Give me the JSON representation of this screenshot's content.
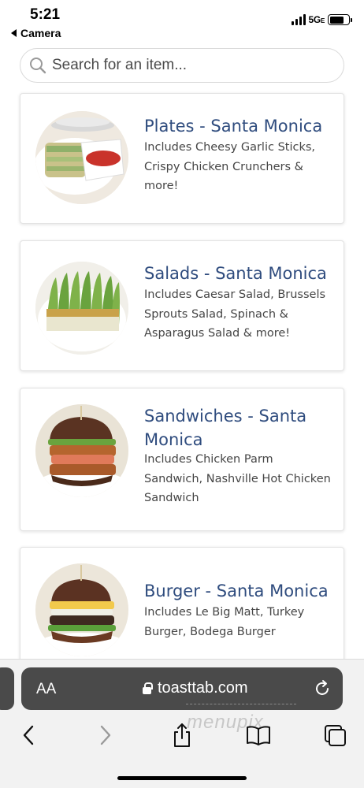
{
  "status": {
    "time": "5:21",
    "back_app": "Camera",
    "network": "5G",
    "network_suffix": "E"
  },
  "search": {
    "placeholder": "Search for an item..."
  },
  "categories": [
    {
      "title": "Plates - Santa Monica",
      "description": "Includes Cheesy Garlic Sticks, Crispy Chicken Crunchers & more!",
      "image_icon": "plates-food-image"
    },
    {
      "title": "Salads - Santa Monica",
      "description": "Includes Caesar Salad, Brussels Sprouts Salad, Spinach & Asparagus Salad & more!",
      "image_icon": "salad-food-image"
    },
    {
      "title": "Sandwiches - Santa Monica",
      "description": "Includes Chicken Parm Sandwich, Nashville Hot Chicken Sandwich",
      "image_icon": "sandwich-food-image"
    },
    {
      "title": "Burger - Santa Monica",
      "description": "Includes Le Big Matt, Turkey Burger, Bodega Burger",
      "image_icon": "burger-food-image"
    }
  ],
  "browser": {
    "text_size_label": "AA",
    "url": "toasttab.com",
    "watermark": "menupix"
  },
  "colors": {
    "title": "#2f4c7e",
    "url_bar": "#4a4a4a"
  }
}
